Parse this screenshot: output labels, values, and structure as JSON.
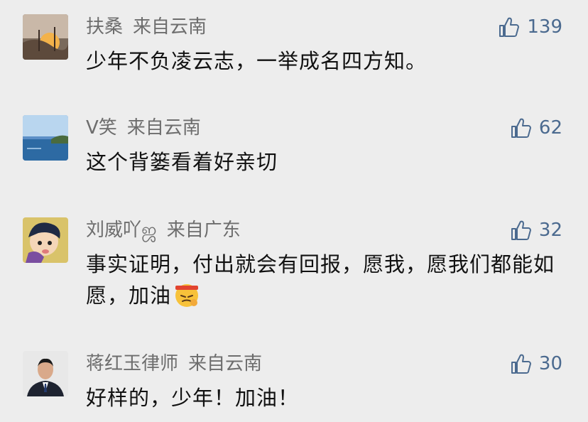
{
  "comments": [
    {
      "name": "扶桑",
      "location": "来自云南",
      "text": "少年不负凌云志，一举成名四方知。",
      "likes": "139",
      "avatar": "sunset-landscape-avatar"
    },
    {
      "name": "V笑",
      "location": "来自云南",
      "text": "这个背篓看着好亲切",
      "likes": "62",
      "avatar": "lake-view-avatar"
    },
    {
      "name": "刘威吖ஜ",
      "location": "来自广东",
      "text": "事实证明，付出就会有回报，愿我，愿我们都能如愿，加油",
      "likes": "32",
      "avatar": "cartoon-avatar",
      "emoji": "determined-face-emoji"
    },
    {
      "name": "蒋红玉律师",
      "location": "来自云南",
      "text": "好样的，少年！加油！",
      "likes": "30",
      "avatar": "lawyer-portrait-avatar"
    }
  ],
  "colors": {
    "background": "#ededed",
    "name": "#6d6d6d",
    "text": "#111111",
    "like": "#4b6a8f"
  },
  "icons": {
    "like": "thumbs-up-outline-icon"
  }
}
